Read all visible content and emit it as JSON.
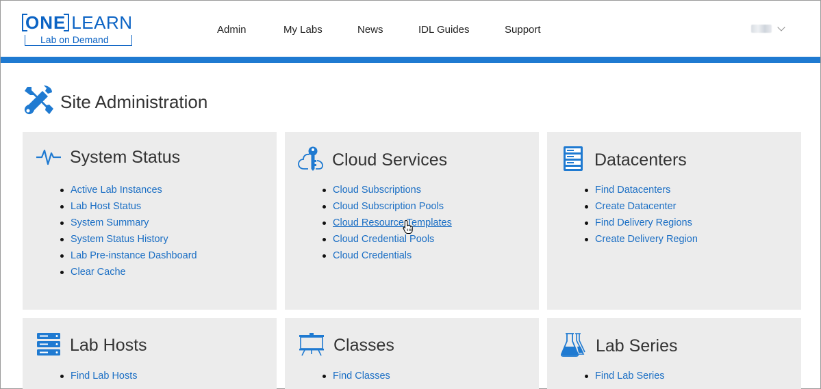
{
  "header": {
    "logo": {
      "one": "ONE",
      "learn": "LEARN",
      "sub": "Lab on Demand"
    },
    "nav": [
      {
        "label": "Admin"
      },
      {
        "label": "My Labs"
      },
      {
        "label": "News"
      },
      {
        "label": "IDL Guides"
      },
      {
        "label": "Support"
      }
    ],
    "accent_color": "#1f7ad1"
  },
  "page": {
    "title": "Site Administration",
    "title_icon": "tools-icon"
  },
  "cards": [
    {
      "title": "System Status",
      "icon": "pulse-icon",
      "links": [
        "Active Lab Instances",
        "Lab Host Status",
        "System Summary",
        "System Status History",
        "Lab Pre-instance Dashboard",
        "Clear Cache"
      ]
    },
    {
      "title": "Cloud Services",
      "icon": "cloud-key-icon",
      "links": [
        "Cloud Subscriptions",
        "Cloud Subscription Pools",
        "Cloud Resource Templates",
        "Cloud Credential Pools",
        "Cloud Credentials"
      ]
    },
    {
      "title": "Datacenters",
      "icon": "server-rack-icon",
      "links": [
        "Find Datacenters",
        "Create Datacenter",
        "Find Delivery Regions",
        "Create Delivery Region"
      ]
    },
    {
      "title": "Lab Hosts",
      "icon": "server-stack-icon",
      "links": [
        "Find Lab Hosts"
      ]
    },
    {
      "title": "Classes",
      "icon": "presentation-board-icon",
      "links": [
        "Find Classes"
      ]
    },
    {
      "title": "Lab Series",
      "icon": "flask-icon",
      "links": [
        "Find Lab Series"
      ]
    }
  ]
}
